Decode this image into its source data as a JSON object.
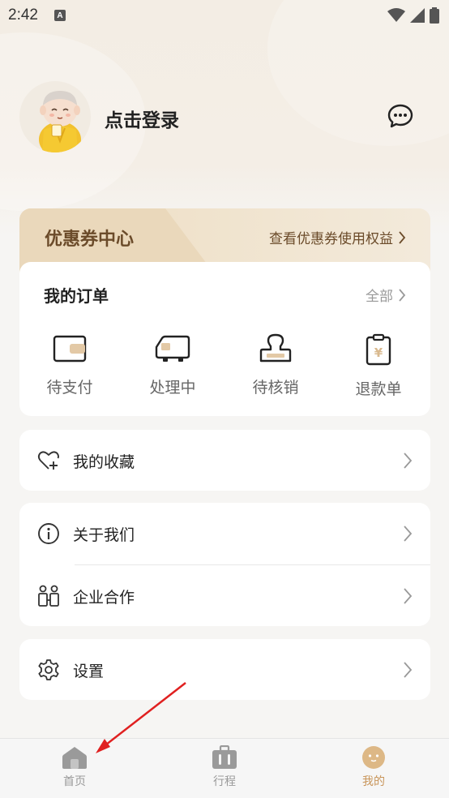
{
  "status_bar": {
    "time": "2:42",
    "notification_icon": "A"
  },
  "profile": {
    "login_text": "点击登录",
    "message_icon": "chat-bubble-icon"
  },
  "coupon": {
    "title": "优惠券中心",
    "link": "查看优惠券使用权益"
  },
  "orders": {
    "title": "我的订单",
    "all_label": "全部",
    "items": [
      {
        "label": "待支付",
        "icon": "wallet-icon"
      },
      {
        "label": "处理中",
        "icon": "truck-icon"
      },
      {
        "label": "待核销",
        "icon": "stamp-icon"
      },
      {
        "label": "退款单",
        "icon": "refund-receipt-icon"
      }
    ]
  },
  "menu": {
    "favorites": "我的收藏",
    "about": "关于我们",
    "cooperation": "企业合作",
    "settings": "设置"
  },
  "tabbar": {
    "tabs": [
      {
        "label": "首页",
        "icon": "home-icon"
      },
      {
        "label": "行程",
        "icon": "suitcase-icon"
      },
      {
        "label": "我的",
        "icon": "mascot-face-icon",
        "active": true
      }
    ]
  },
  "colors": {
    "accent": "#c8955a",
    "coupon_text": "#6b4b2a",
    "annotation_arrow": "#e02020"
  }
}
